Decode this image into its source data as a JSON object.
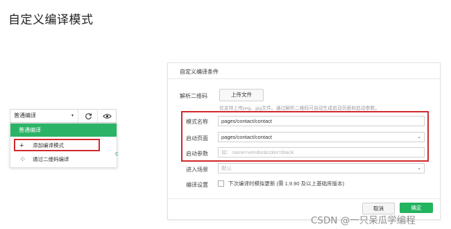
{
  "heading": "自定义编译模式",
  "toolbar": {
    "mode_select_value": "普通编译",
    "mode_select_caret": "▾",
    "refresh_icon": "refresh-icon",
    "preview_icon": "eye-icon"
  },
  "dropdown": {
    "items": [
      {
        "label": "普通编译",
        "selected": true
      },
      {
        "label": "添加编译模式",
        "icon": "plus-icon",
        "icon_glyph": "+"
      },
      {
        "label": "通过二维码编译",
        "icon": "qrcode-icon",
        "icon_glyph": "⁘"
      }
    ]
  },
  "dialog": {
    "title": "自定义编译条件",
    "qr_label": "解析二维码",
    "upload_button": "上传文件",
    "upload_hint": "仅支持上传png、jpg文件。通过解析二维码可自动生成启动页面和启动参数。",
    "mode_name_label": "模式名称",
    "mode_name_value": "pages/contact/contact",
    "start_page_label": "启动页面",
    "start_page_value": "pages/contact/contact",
    "start_params_label": "启动参数",
    "start_params_placeholder": "如：name=vendor&color=black",
    "scene_label": "进入场景",
    "scene_value": "默认",
    "compile_settings_label": "编译设置",
    "compile_checkbox_label": "下次编译时模拟更新 (需 1.9.90 及以上基础库版本)",
    "compile_checkbox_checked": false,
    "cancel_button": "取消",
    "confirm_button": "确定"
  },
  "watermark": "CSDN @一只呆瓜学编程",
  "colors": {
    "accent_green": "#2bb467",
    "highlight_red": "#d0282c"
  }
}
